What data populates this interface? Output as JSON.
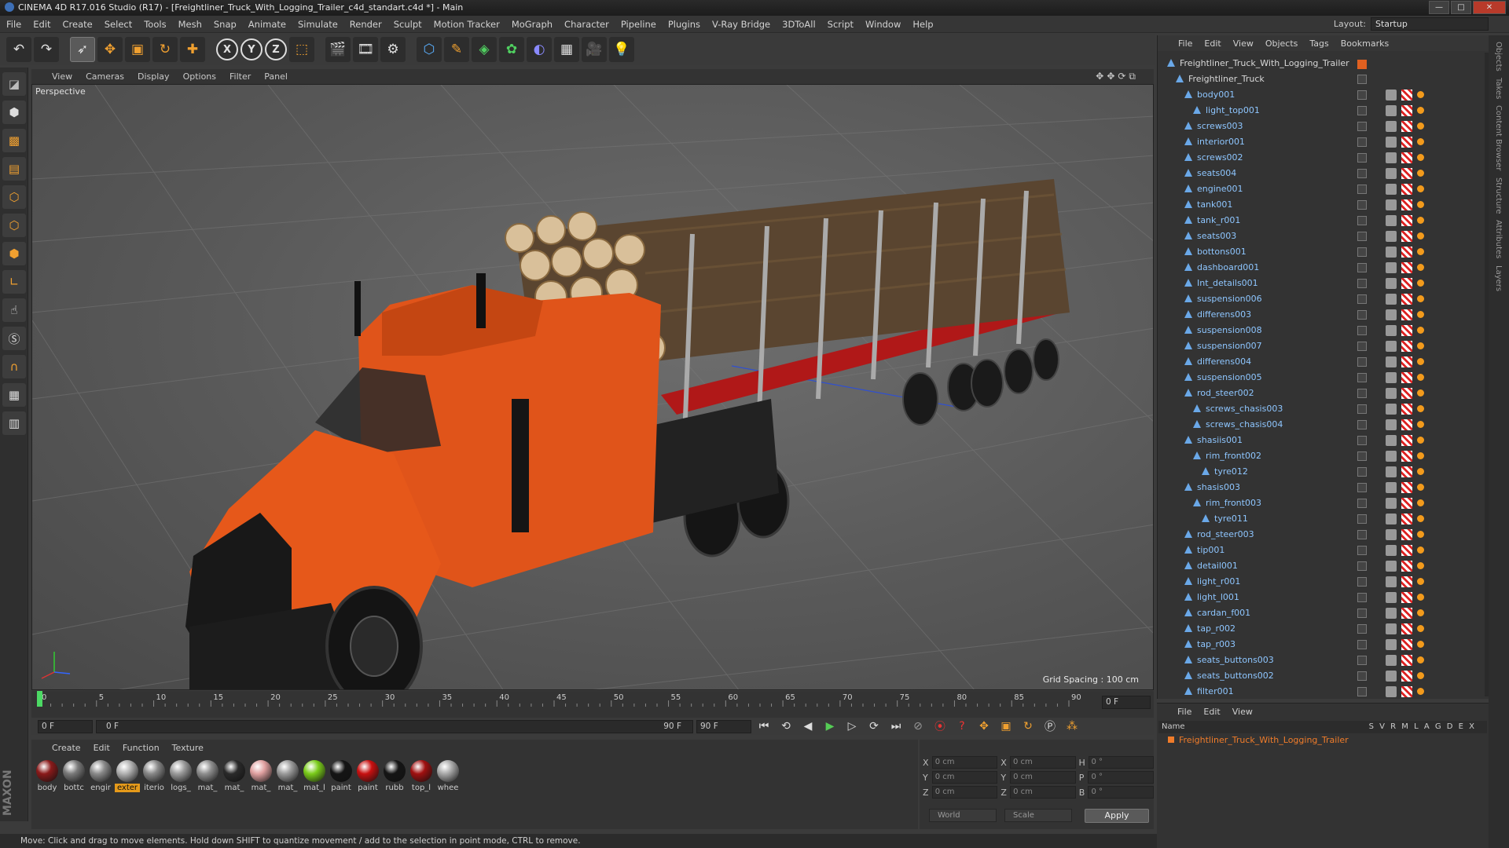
{
  "window": {
    "title": "CINEMA 4D R17.016 Studio (R17) - [Freightliner_Truck_With_Logging_Trailer_c4d_standart.c4d *] - Main"
  },
  "menubar": [
    "File",
    "Edit",
    "Create",
    "Select",
    "Tools",
    "Mesh",
    "Snap",
    "Animate",
    "Simulate",
    "Render",
    "Sculpt",
    "Motion Tracker",
    "MoGraph",
    "Character",
    "Pipeline",
    "Plugins",
    "V-Ray Bridge",
    "3DToAll",
    "Script",
    "Window",
    "Help"
  ],
  "layout": {
    "label": "Layout:",
    "value": "Startup"
  },
  "toolbar": {
    "icons": [
      "undo-icon",
      "redo-icon",
      "select-icon",
      "move-icon",
      "scale-icon",
      "rotate-icon",
      "add-icon",
      "x-axis",
      "y-axis",
      "z-axis",
      "coord-system",
      "render-view",
      "render-picture",
      "edit-render",
      "cube-icon",
      "pen-icon",
      "subdivision-icon",
      "array-icon",
      "deformer-icon",
      "floor-icon",
      "camera-icon",
      "light-icon"
    ],
    "axis_labels": [
      "X",
      "Y",
      "Z"
    ]
  },
  "viewport": {
    "menu": [
      "View",
      "Cameras",
      "Display",
      "Options",
      "Filter",
      "Panel"
    ],
    "label": "Perspective",
    "grid_spacing": "Grid Spacing : 100 cm"
  },
  "timeline": {
    "ticks": [
      "0",
      "5",
      "10",
      "15",
      "20",
      "25",
      "30",
      "35",
      "40",
      "45",
      "50",
      "55",
      "60",
      "65",
      "70",
      "75",
      "80",
      "85",
      "90"
    ],
    "current_frame": "0 F",
    "start": "0 F",
    "range_start": "0 F",
    "range_end": "90 F",
    "end": "90 F"
  },
  "materials": {
    "menu": [
      "Create",
      "Edit",
      "Function",
      "Texture"
    ],
    "items": [
      {
        "label": "body",
        "color": "#8a1a1a"
      },
      {
        "label": "bottc",
        "color": "#7a7a7a"
      },
      {
        "label": "engir",
        "color": "#8a8a8a"
      },
      {
        "label": "exter",
        "color": "#b0b0b0",
        "selected": true
      },
      {
        "label": "iterio",
        "color": "#888"
      },
      {
        "label": "logs_",
        "color": "#9a9a9a"
      },
      {
        "label": "mat_",
        "color": "#8e8e8e"
      },
      {
        "label": "mat_",
        "color": "#2a2a2a"
      },
      {
        "label": "mat_",
        "color": "#e0a0a0"
      },
      {
        "label": "mat_",
        "color": "#9a9a9a"
      },
      {
        "label": "mat_l",
        "color": "#7acc1a"
      },
      {
        "label": "paint",
        "color": "#151515"
      },
      {
        "label": "paint",
        "color": "#c81010"
      },
      {
        "label": "rubb",
        "color": "#151515"
      },
      {
        "label": "top_l",
        "color": "#a01010"
      },
      {
        "label": "whee",
        "color": "#a8a8a8"
      }
    ]
  },
  "coords": {
    "rows": [
      {
        "a": "X",
        "av": "0 cm",
        "b": "X",
        "bv": "0 cm",
        "c": "H",
        "cv": "0 °"
      },
      {
        "a": "Y",
        "av": "0 cm",
        "b": "Y",
        "bv": "0 cm",
        "c": "P",
        "cv": "0 °"
      },
      {
        "a": "Z",
        "av": "0 cm",
        "b": "Z",
        "bv": "0 cm",
        "c": "B",
        "cv": "0 °"
      }
    ],
    "world": "World",
    "scale": "Scale",
    "apply": "Apply"
  },
  "status": "Move: Click and drag to move elements. Hold down SHIFT to quantize movement / add to the selection in point mode, CTRL to remove.",
  "objects": {
    "menu": [
      "File",
      "Edit",
      "View",
      "Objects",
      "Tags",
      "Bookmarks"
    ],
    "tree": [
      {
        "name": "Freightliner_Truck_With_Logging_Trailer",
        "indent": 0,
        "color": "#d8d8d8"
      },
      {
        "name": "Freightliner_Truck",
        "indent": 1,
        "color": "#d8d8d8"
      },
      {
        "name": "body001",
        "indent": 2
      },
      {
        "name": "light_top001",
        "indent": 3
      },
      {
        "name": "screws003",
        "indent": 2
      },
      {
        "name": "interior001",
        "indent": 2
      },
      {
        "name": "screws002",
        "indent": 2
      },
      {
        "name": "seats004",
        "indent": 2
      },
      {
        "name": "engine001",
        "indent": 2
      },
      {
        "name": "tank001",
        "indent": 2
      },
      {
        "name": "tank_r001",
        "indent": 2
      },
      {
        "name": "seats003",
        "indent": 2
      },
      {
        "name": "bottons001",
        "indent": 2
      },
      {
        "name": "dashboard001",
        "indent": 2
      },
      {
        "name": "Int_details001",
        "indent": 2
      },
      {
        "name": "suspension006",
        "indent": 2
      },
      {
        "name": "differens003",
        "indent": 2
      },
      {
        "name": "suspension008",
        "indent": 2
      },
      {
        "name": "suspension007",
        "indent": 2
      },
      {
        "name": "differens004",
        "indent": 2
      },
      {
        "name": "suspension005",
        "indent": 2
      },
      {
        "name": "rod_steer002",
        "indent": 2
      },
      {
        "name": "screws_chasis003",
        "indent": 3
      },
      {
        "name": "screws_chasis004",
        "indent": 3
      },
      {
        "name": "shasiis001",
        "indent": 2
      },
      {
        "name": "rim_front002",
        "indent": 3
      },
      {
        "name": "tyre012",
        "indent": 4
      },
      {
        "name": "shasis003",
        "indent": 2
      },
      {
        "name": "rim_front003",
        "indent": 3
      },
      {
        "name": "tyre011",
        "indent": 4
      },
      {
        "name": "rod_steer003",
        "indent": 2
      },
      {
        "name": "tip001",
        "indent": 2
      },
      {
        "name": "detail001",
        "indent": 2
      },
      {
        "name": "light_r001",
        "indent": 2
      },
      {
        "name": "light_l001",
        "indent": 2
      },
      {
        "name": "cardan_f001",
        "indent": 2
      },
      {
        "name": "tap_r002",
        "indent": 2
      },
      {
        "name": "tap_r003",
        "indent": 2
      },
      {
        "name": "seats_buttons003",
        "indent": 2
      },
      {
        "name": "seats_buttons002",
        "indent": 2
      },
      {
        "name": "filter001",
        "indent": 2
      }
    ]
  },
  "layers": {
    "menu": [
      "File",
      "Edit",
      "View"
    ],
    "header": "Name",
    "cols": "S V R M L A G D E X",
    "row": "Freightliner_Truck_With_Logging_Trailer"
  },
  "right_tabs": [
    "Objects",
    "Takes",
    "Content Browser",
    "Structure",
    "Attributes",
    "Layers"
  ]
}
